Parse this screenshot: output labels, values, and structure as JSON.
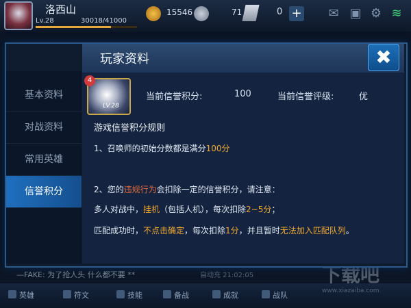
{
  "player": {
    "name": "洛西山",
    "level": "Lv.28",
    "exp": "30018/41000"
  },
  "resources": {
    "gold": "15546",
    "tickets": "71",
    "diamonds": "0"
  },
  "dialog": {
    "title": "玩家资料",
    "close_icon": "close-x",
    "tabs": [
      {
        "label": "基本资料"
      },
      {
        "label": "对战资料"
      },
      {
        "label": "常用英雄"
      },
      {
        "label": "信誉积分",
        "active": true
      }
    ],
    "hero": {
      "badge": "4",
      "level": "LV.28"
    },
    "credit": {
      "score_label": "当前信誉积分:",
      "score": "100",
      "grade_label": "当前信誉评级:",
      "grade": "优"
    },
    "rules": {
      "title": "游戏信誉积分规则",
      "r1_prefix": "1、召唤师的初始分数都是满分",
      "r1_value": "100分",
      "r2_prefix": "2、您的",
      "r2_hl": "违规行为",
      "r2_suffix": "会扣除一定的信誉积分，请注意：",
      "r3_prefix": "多人对战中，",
      "r3_hl": "挂机",
      "r3_mid": "（包括人机），每次扣除",
      "r3_value": "2~5分",
      "r3_end": "；",
      "r4_prefix": "匹配成功时，",
      "r4_hl": "不点击确定",
      "r4_mid": "，每次扣除",
      "r4_value": "1分",
      "r4_mid2": "，并且暂时",
      "r4_hl2": "无法加入匹配队列",
      "r4_end": "。"
    }
  },
  "chat": {
    "message": "—FAKE: 为了抢人头 什么都不要 **",
    "right": "自动充 21:02:05"
  },
  "nav": [
    {
      "label": "英雄"
    },
    {
      "label": "符文"
    },
    {
      "label": "技能"
    },
    {
      "label": "备战"
    },
    {
      "label": "成就"
    },
    {
      "label": "战队"
    }
  ],
  "watermark": {
    "main": "下载吧",
    "sub": "www.xiazaiba.com"
  },
  "colors": {
    "accent": "#1f6fbf",
    "highlight": "#f0a830",
    "warning": "#e46b3c"
  }
}
